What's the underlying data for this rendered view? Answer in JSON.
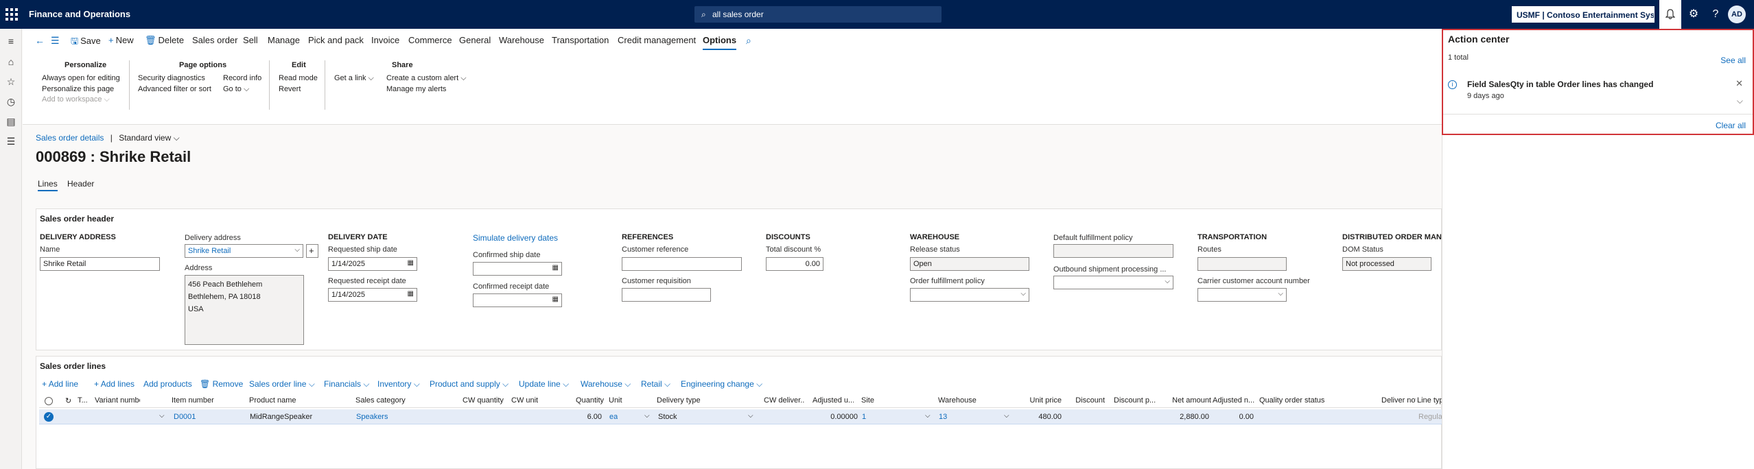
{
  "topbar": {
    "app_name": "Finance and Operations",
    "search_text": "all sales order",
    "company": "USMF | Contoso Entertainment Syste...",
    "avatar_initials": "AD"
  },
  "action_pane": {
    "items": [
      "Save",
      "New",
      "Delete",
      "Sales order",
      "Sell",
      "Manage",
      "Pick and pack",
      "Invoice",
      "Commerce",
      "General",
      "Warehouse",
      "Transportation",
      "Credit management",
      "Options"
    ],
    "active": "Options",
    "groups": {
      "personalize": {
        "title": "Personalize",
        "links": [
          "Always open for editing",
          "Personalize this page",
          "Add to workspace"
        ]
      },
      "page_options": {
        "title": "Page options",
        "links": [
          "Security diagnostics",
          "Advanced filter or sort",
          "Record info",
          "Go to"
        ]
      },
      "edit": {
        "title": "Edit",
        "links": [
          "Read mode",
          "Revert"
        ]
      },
      "share": {
        "title": "Share",
        "links": [
          "Get a link",
          "Create a custom alert",
          "Manage my alerts"
        ]
      }
    }
  },
  "breadcrumb": {
    "link": "Sales order details",
    "separator": "|",
    "view": "Standard view"
  },
  "page_title": "000869 : Shrike Retail",
  "tabs": [
    "Lines",
    "Header"
  ],
  "header_section": {
    "title": "Sales order header",
    "delivery_address": {
      "title": "DELIVERY ADDRESS",
      "name_label": "Name",
      "name_value": "Shrike Retail",
      "address_select_label": "Delivery address",
      "address_select_value": "Shrike Retail",
      "address_label": "Address",
      "address_lines": [
        "456 Peach Bethlehem",
        "Bethlehem, PA 18018",
        "USA"
      ]
    },
    "delivery_date": {
      "title": "DELIVERY DATE",
      "ship_label": "Requested ship date",
      "ship_value": "1/14/2025",
      "receipt_label": "Requested receipt date",
      "receipt_value": "1/14/2025",
      "simulate_link": "Simulate delivery dates",
      "conf_ship_label": "Confirmed ship date",
      "conf_receipt_label": "Confirmed receipt date"
    },
    "references": {
      "title": "REFERENCES",
      "cust_ref_label": "Customer reference",
      "cust_req_label": "Customer requisition"
    },
    "discounts": {
      "title": "DISCOUNTS",
      "total_label": "Total discount %",
      "total_value": "0.00"
    },
    "warehouse": {
      "title": "WAREHOUSE",
      "release_label": "Release status",
      "release_value": "Open",
      "policy_label": "Order fulfillment policy",
      "default_policy_label": "Default fulfillment policy",
      "outbound_label": "Outbound shipment processing ..."
    },
    "transportation": {
      "title": "TRANSPORTATION",
      "routes_label": "Routes",
      "carrier_label": "Carrier customer account number"
    },
    "dom": {
      "title": "DISTRIBUTED ORDER MANA",
      "status_label": "DOM Status",
      "status_value": "Not processed"
    }
  },
  "lines_section": {
    "title": "Sales order lines",
    "toolbar": [
      "Add line",
      "Add lines",
      "Add products",
      "Remove",
      "Sales order line",
      "Financials",
      "Inventory",
      "Product and supply",
      "Update line",
      "Warehouse",
      "Retail",
      "Engineering change"
    ],
    "columns": [
      "T...",
      "Variant number",
      "Item number",
      "Product name",
      "Sales category",
      "CW quantity",
      "CW unit",
      "Quantity",
      "Unit",
      "Delivery type",
      "CW deliver...",
      "Adjusted u...",
      "Site",
      "Warehouse",
      "Unit price",
      "Discount",
      "Discount p...",
      "Net amount",
      "Adjusted n...",
      "Quality order status",
      "Deliver now",
      "Line typ"
    ],
    "row": {
      "item_number": "D0001",
      "product_name": "MidRangeSpeaker",
      "sales_category": "Speakers",
      "quantity": "6.00",
      "unit": "ea",
      "delivery_type": "Stock",
      "adjusted_unit": "0.00000",
      "site": "1",
      "warehouse": "13",
      "unit_price": "480.00",
      "net_amount": "2,880.00",
      "adjusted_net": "0.00",
      "line_type": "Regular"
    }
  },
  "action_center": {
    "title": "Action center",
    "total": "1 total",
    "see_all": "See all",
    "notification": {
      "text": "Field SalesQty in table Order lines has changed",
      "time": "9 days ago"
    },
    "clear_all": "Clear all",
    "highlight_color": "#d13438"
  }
}
